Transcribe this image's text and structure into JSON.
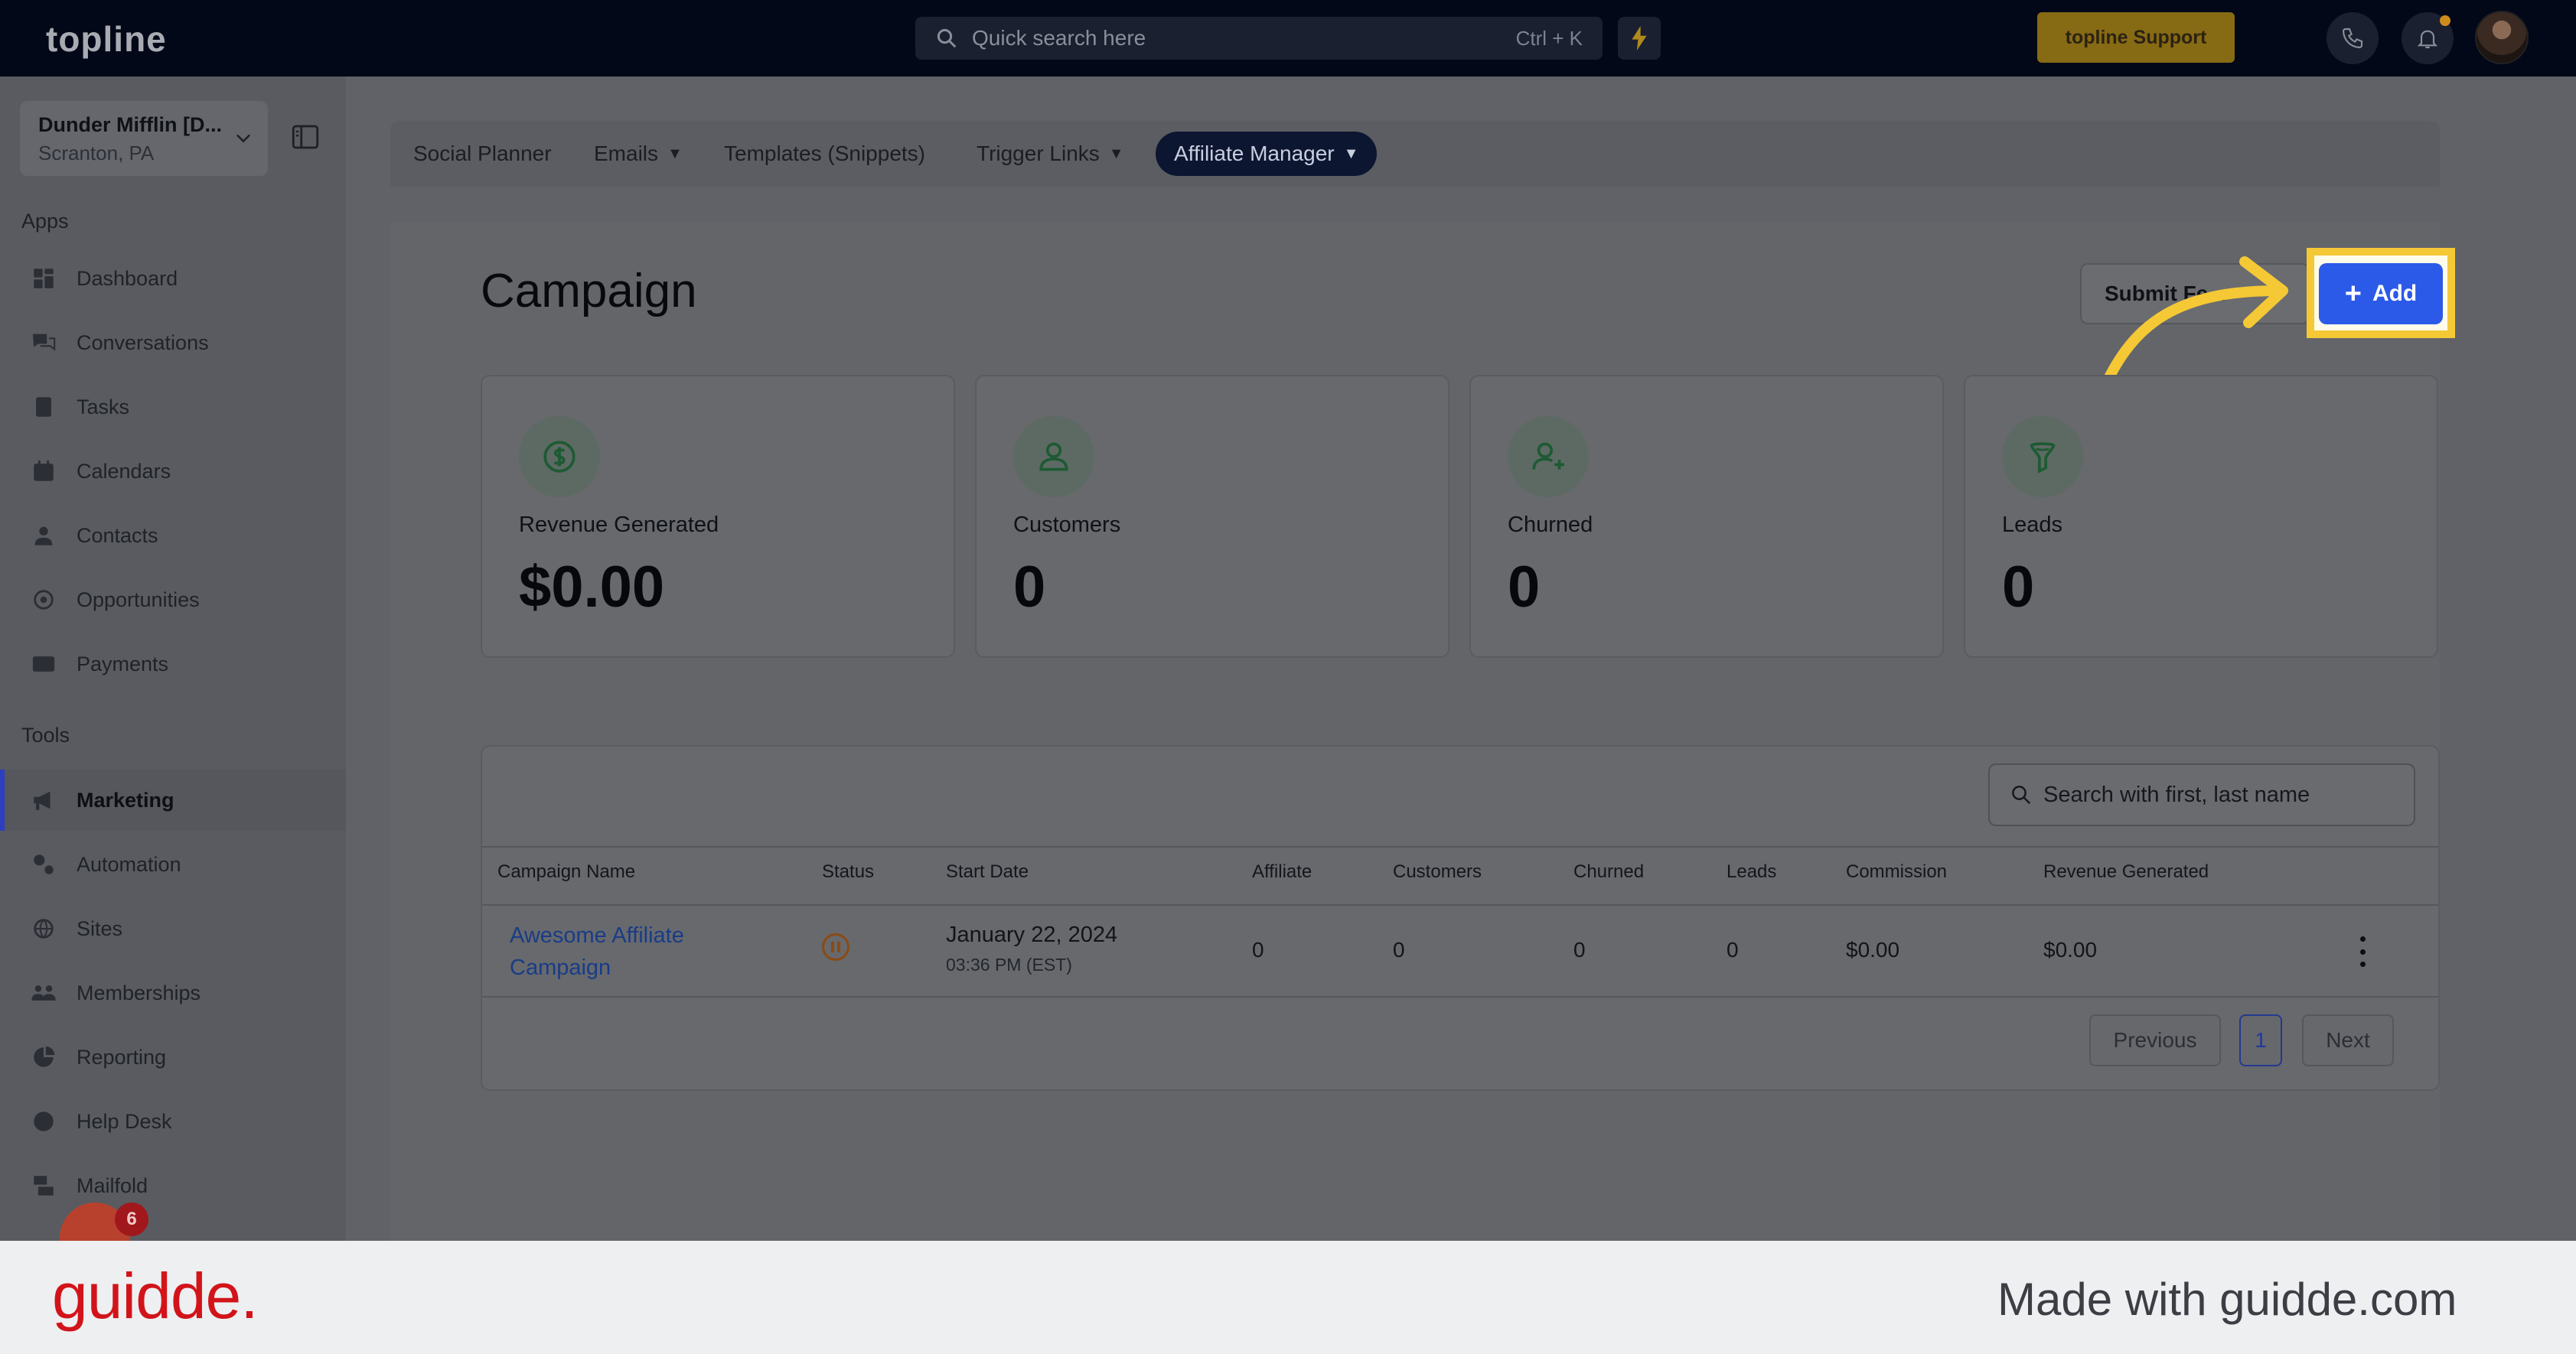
{
  "topbar": {
    "logo": "topline",
    "search_placeholder": "Quick search here",
    "search_shortcut": "Ctrl + K",
    "support_label": "topline Support"
  },
  "sidebar": {
    "account_name": "Dunder Mifflin [D...",
    "account_location": "Scranton, PA",
    "apps_title": "Apps",
    "apps": [
      {
        "label": "Dashboard",
        "icon": "dashboard-icon"
      },
      {
        "label": "Conversations",
        "icon": "conversations-icon"
      },
      {
        "label": "Tasks",
        "icon": "tasks-icon"
      },
      {
        "label": "Calendars",
        "icon": "calendar-icon"
      },
      {
        "label": "Contacts",
        "icon": "contacts-icon"
      },
      {
        "label": "Opportunities",
        "icon": "opportunities-icon"
      },
      {
        "label": "Payments",
        "icon": "payments-icon"
      }
    ],
    "tools_title": "Tools",
    "tools": [
      {
        "label": "Marketing",
        "icon": "megaphone-icon",
        "active": true
      },
      {
        "label": "Automation",
        "icon": "automation-icon"
      },
      {
        "label": "Sites",
        "icon": "sites-icon"
      },
      {
        "label": "Memberships",
        "icon": "memberships-icon"
      },
      {
        "label": "Reporting",
        "icon": "reporting-icon"
      },
      {
        "label": "Help Desk",
        "icon": "help-icon"
      },
      {
        "label": "Mailfold",
        "icon": "mailfold-icon"
      }
    ],
    "chat_badge": "6"
  },
  "tabs": [
    {
      "label": "Social Planner",
      "dropdown": false
    },
    {
      "label": "Emails",
      "dropdown": true
    },
    {
      "label": "Templates (Snippets)",
      "dropdown": false
    },
    {
      "label": "Trigger Links",
      "dropdown": true
    },
    {
      "label": "Affiliate Manager",
      "dropdown": true,
      "selected": true
    }
  ],
  "page": {
    "title": "Campaign",
    "submit_label": "Submit Fe...",
    "add_label": "Add"
  },
  "stats": [
    {
      "label": "Revenue Generated",
      "value": "$0.00",
      "icon": "dollar-icon"
    },
    {
      "label": "Customers",
      "value": "0",
      "icon": "user-icon"
    },
    {
      "label": "Churned",
      "value": "0",
      "icon": "user-plus-icon"
    },
    {
      "label": "Leads",
      "value": "0",
      "icon": "funnel-icon"
    }
  ],
  "table": {
    "search_placeholder": "Search with first, last name",
    "columns": [
      "Campaign Name",
      "Status",
      "Start Date",
      "Affiliate",
      "Customers",
      "Churned",
      "Leads",
      "Commission",
      "Revenue Generated"
    ],
    "rows": [
      {
        "campaign_name": "Awesome Affiliate Campaign",
        "status": "paused",
        "start_date": "January 22, 2024",
        "start_time": "03:36 PM (EST)",
        "affiliate": "0",
        "customers": "0",
        "churned": "0",
        "leads": "0",
        "commission": "$0.00",
        "revenue": "$0.00"
      }
    ],
    "pagination": {
      "previous": "Previous",
      "current": "1",
      "next": "Next"
    }
  },
  "footer": {
    "brand": "guidde.",
    "made_with": "Made with guidde.com"
  },
  "colors": {
    "highlight": "#f5c835",
    "add_button": "#2c5ae8",
    "brand_red": "#d2141a"
  }
}
